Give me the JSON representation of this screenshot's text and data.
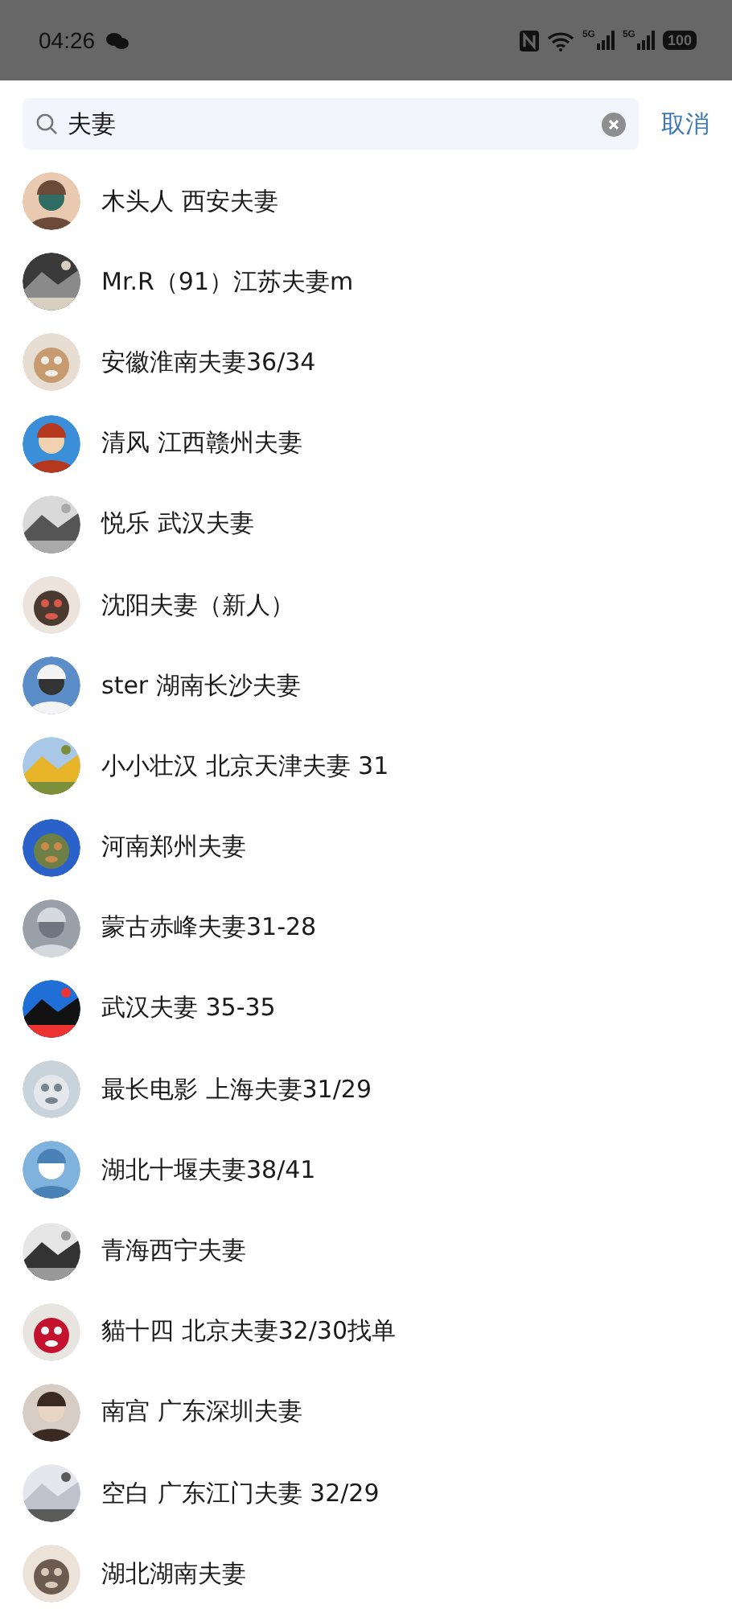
{
  "status_bar": {
    "time": "04:26",
    "network_labels": [
      "5G",
      "5G"
    ],
    "battery": "100"
  },
  "search": {
    "value": "夫妻",
    "cancel": "取消"
  },
  "results": [
    {
      "name": "木头人 西安夫妻"
    },
    {
      "name": "Mr.R（91）江苏夫妻m"
    },
    {
      "name": "安徽淮南夫妻36/34"
    },
    {
      "name": "清风 江西赣州夫妻"
    },
    {
      "name": "悦乐  武汉夫妻"
    },
    {
      "name": "沈阳夫妻（新人）"
    },
    {
      "name": "ster 湖南长沙夫妻"
    },
    {
      "name": "小小壮汉 北京天津夫妻 31"
    },
    {
      "name": "河南郑州夫妻"
    },
    {
      "name": "蒙古赤峰夫妻31-28"
    },
    {
      "name": "武汉夫妻 35-35"
    },
    {
      "name": "最长电影  上海夫妻31/29"
    },
    {
      "name": "湖北十堰夫妻38/41"
    },
    {
      "name": "青海西宁夫妻"
    },
    {
      "name": "貓十四  北京夫妻32/30找单"
    },
    {
      "name": "南宫  广东深圳夫妻"
    },
    {
      "name": "空白 广东江门夫妻 32/29"
    },
    {
      "name": "湖北湖南夫妻"
    }
  ]
}
